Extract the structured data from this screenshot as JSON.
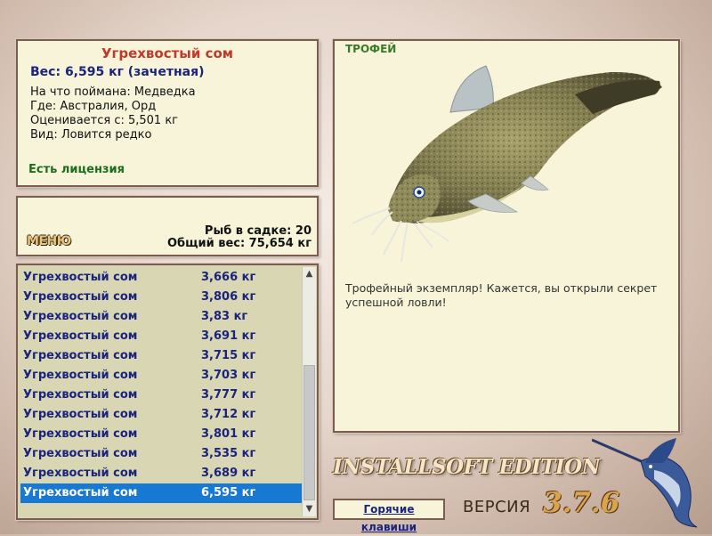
{
  "info": {
    "title": "Угрехвостый сом",
    "weight": "Вес: 6,595 кг (зачетная)",
    "bait": "На что поймана: Медведка",
    "location": "Где: Австралия, Орд",
    "value": "Оценивается с: 5,501 кг",
    "kind": "Вид: Ловится редко",
    "license": "Есть лицензия"
  },
  "cage": {
    "menu_label": "МЕНЮ",
    "count": "Рыб в садке: 20",
    "total": "Общий вес: 75,654 кг"
  },
  "catch_list": {
    "rows": [
      {
        "name": "Угрехвостый сом",
        "weight": "3,666 кг"
      },
      {
        "name": "Угрехвостый сом",
        "weight": "3,806 кг"
      },
      {
        "name": "Угрехвостый сом",
        "weight": "3,83 кг"
      },
      {
        "name": "Угрехвостый сом",
        "weight": "3,691 кг"
      },
      {
        "name": "Угрехвостый сом",
        "weight": "3,715 кг"
      },
      {
        "name": "Угрехвостый сом",
        "weight": "3,703 кг"
      },
      {
        "name": "Угрехвостый сом",
        "weight": "3,777 кг"
      },
      {
        "name": "Угрехвостый сом",
        "weight": "3,712 кг"
      },
      {
        "name": "Угрехвостый сом",
        "weight": "3,801 кг"
      },
      {
        "name": "Угрехвостый сом",
        "weight": "3,535 кг"
      },
      {
        "name": "Угрехвостый сом",
        "weight": "3,689 кг"
      },
      {
        "name": "Угрехвостый сом",
        "weight": "6,595 кг"
      }
    ],
    "selected_index": 11
  },
  "trophy": {
    "label": "ТРОФЕЙ",
    "description": "Трофейный экземпляр! Кажется, вы открыли секрет успешной ловли!"
  },
  "footer": {
    "brand": "INSTALLSOFT EDITION",
    "hotkeys_label": "Горячие клавиши",
    "version_label": "ВЕРСИЯ",
    "version_number": "3.7.6"
  },
  "colors": {
    "panel_bg": "#f7f4d9",
    "panel_border": "#7a5d4e",
    "title_red": "#c0392b",
    "text_navy": "#1a237e",
    "license_green": "#1b6e1b",
    "selection_blue": "#1779d4"
  }
}
